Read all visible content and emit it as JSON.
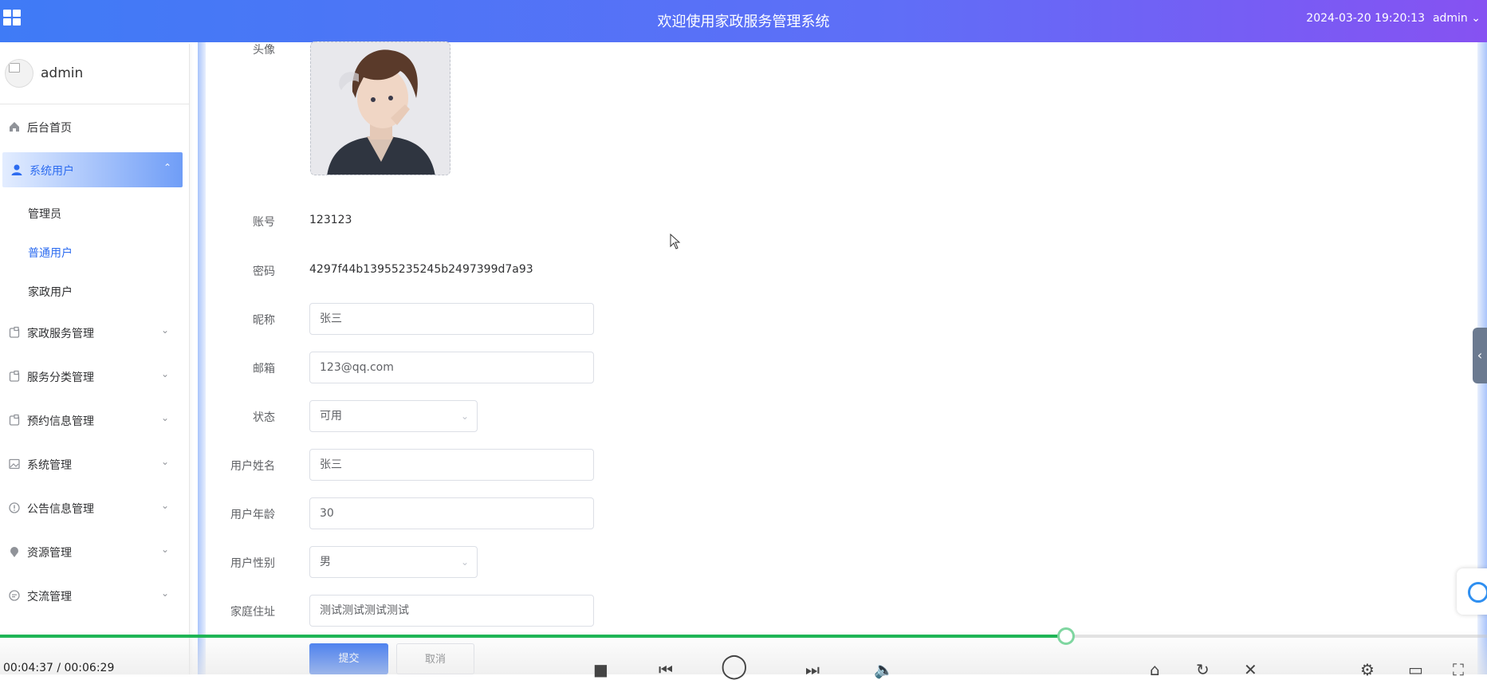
{
  "header": {
    "title": "欢迎使用家政服务管理系统",
    "datetime": "2024-03-20 19:20:13",
    "user": "admin"
  },
  "sidebar": {
    "profile_name": "admin",
    "items": [
      {
        "label": "后台首页",
        "icon": "home-icon"
      },
      {
        "label": "系统用户",
        "icon": "user-icon",
        "active": true
      },
      {
        "label": "家政服务管理",
        "icon": "document-icon"
      },
      {
        "label": "服务分类管理",
        "icon": "document-icon"
      },
      {
        "label": "预约信息管理",
        "icon": "document-icon"
      },
      {
        "label": "系统管理",
        "icon": "picture-icon"
      },
      {
        "label": "公告信息管理",
        "icon": "info-icon"
      },
      {
        "label": "资源管理",
        "icon": "location-icon"
      },
      {
        "label": "交流管理",
        "icon": "chat-icon"
      }
    ],
    "sub_items": [
      {
        "label": "管理员"
      },
      {
        "label": "普通用户",
        "current": true
      },
      {
        "label": "家政用户"
      }
    ]
  },
  "form": {
    "avatar_label": "头像",
    "account_label": "账号",
    "account_value": "123123",
    "password_label": "密码",
    "password_value": "4297f44b13955235245b2497399d7a93",
    "nickname_label": "昵称",
    "nickname_value": "张三",
    "email_label": "邮箱",
    "email_value": "123@qq.com",
    "status_label": "状态",
    "status_value": "可用",
    "name_label": "用户姓名",
    "name_value": "张三",
    "age_label": "用户年龄",
    "age_value": "30",
    "gender_label": "用户性别",
    "gender_value": "男",
    "address_label": "家庭住址",
    "address_value": "测试测试测试测试",
    "submit_label": "提交",
    "cancel_label": "取消"
  },
  "player": {
    "time": "00:04:37 / 00:06:29",
    "progress": 0.717,
    "accent": "#1fb556"
  },
  "colors": {
    "primary": "#2d6cf0",
    "header_start": "#3f7bf6",
    "header_end": "#8652f2"
  }
}
